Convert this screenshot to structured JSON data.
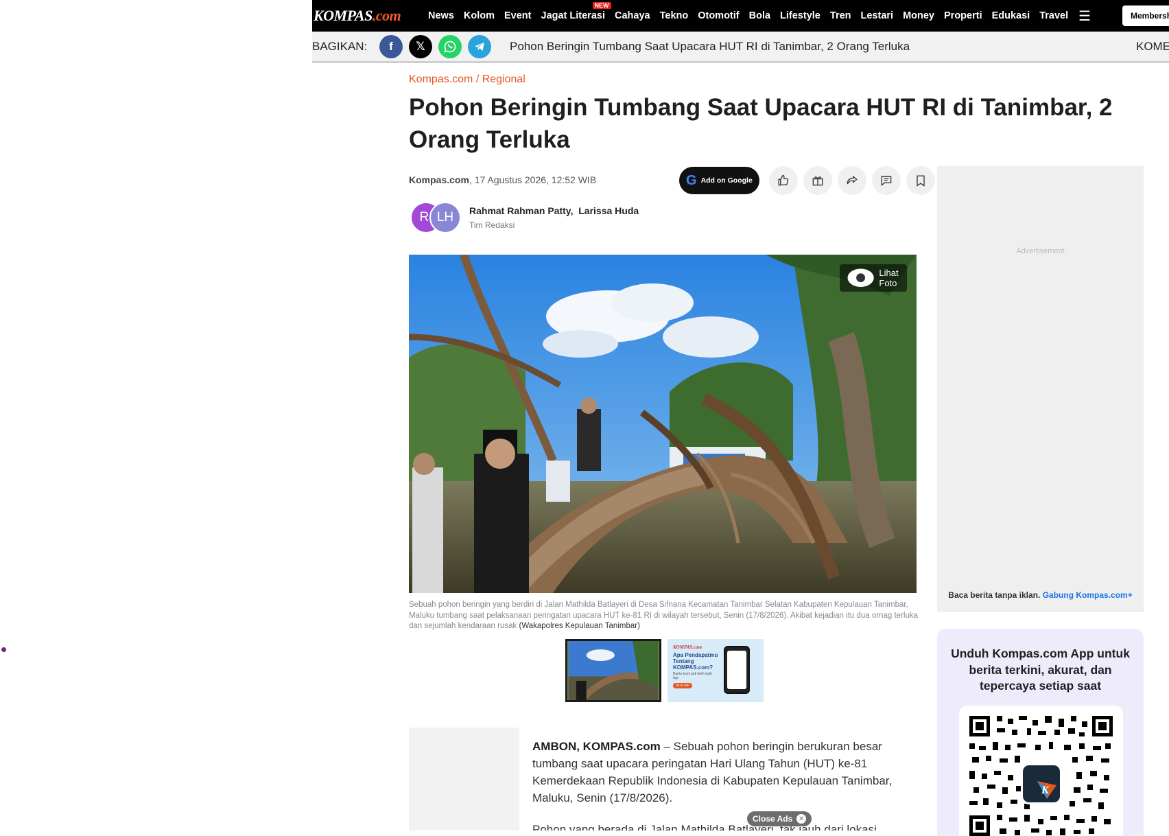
{
  "header": {
    "logo_main": "KOMPAS",
    "logo_suffix": ".com",
    "nav": [
      "News",
      "Kolom",
      "Event",
      "Jagat Literasi",
      "Cahaya",
      "Tekno",
      "Otomotif",
      "Bola",
      "Lifestyle",
      "Tren",
      "Lestari",
      "Money",
      "Properti",
      "Edukasi",
      "Travel"
    ],
    "new_badge": "NEW",
    "menu_icon": "hamburger-icon",
    "member_label": "Membership"
  },
  "sharebar": {
    "label": "BAGIKAN:",
    "title": "Pohon Beringin Tumbang Saat Upacara HUT RI di Tanimbar, 2 Orang Terluka",
    "right_text": "KOMENTAR"
  },
  "article": {
    "breadcrumb": "Kompas.com / Regional",
    "headline": "Pohon Beringin Tumbang Saat Upacara HUT RI di Tanimbar, 2 Orang Terluka",
    "source": "Kompas.com",
    "date": ", 17 Agustus 2026, 12:52 WIB",
    "add_google": "Add on Google",
    "authors": {
      "avatar1": "RI",
      "avatar2": "LH",
      "name1": "Rahmat Rahman Patty",
      "name2": "Larissa Huda",
      "team": "Tim Redaksi"
    },
    "photo_button": "Lihat Foto",
    "caption": "Sebuah pohon beringin yang berdiri di Jalan Mathilda Batlayeri di Desa Sifnana Kecamatan Tanimbar Selatan Kabupaten Kepulauan Tanimbar, Maluku tumbang saat pelaksanaan peringatan upacara HUT ke-81 RI di wilayah tersebut, Senin (17/8/2026). Akibat kejadian itu dua ornag terluka dan sejumlah kendaraan rusak",
    "caption_credit": "(Wakapolres Kepulauan Tanimbar)",
    "thumb2": {
      "brand": "KOMPAS.com",
      "text": "Apa Pendapatmu Tentang KOMPAS.com?",
      "sub": "Bantu kami jadi lebih baik lagi",
      "pill": "Isi di sini"
    },
    "lead_bold": "AMBON, KOMPAS.com",
    "lead_text": " – Sebuah pohon beringin berukuran besar tumbang saat upacara peringatan Hari Ulang Tahun (HUT) ke-81 Kemerdekaan Republik Indonesia di Kabupaten Kepulauan Tanimbar, Maluku, Senin (17/8/2026).",
    "para2": "Pohon yang berada di Jalan Mathilda Batlayeri, tak jauh dari lokasi",
    "close_ads": "Close Ads"
  },
  "sidebar": {
    "ad_label": "Advertisement",
    "ad_cta_text": "Baca berita tanpa iklan.",
    "ad_cta_link": "Gabung Kompas.com+",
    "app_title": "Unduh Kompas.com App untuk berita terkini, akurat, dan tepercaya setiap saat",
    "qr_logo": "K"
  },
  "colors": {
    "accent": "#e4571f",
    "nav_bg": "#000000",
    "link": "#1a73e8"
  }
}
